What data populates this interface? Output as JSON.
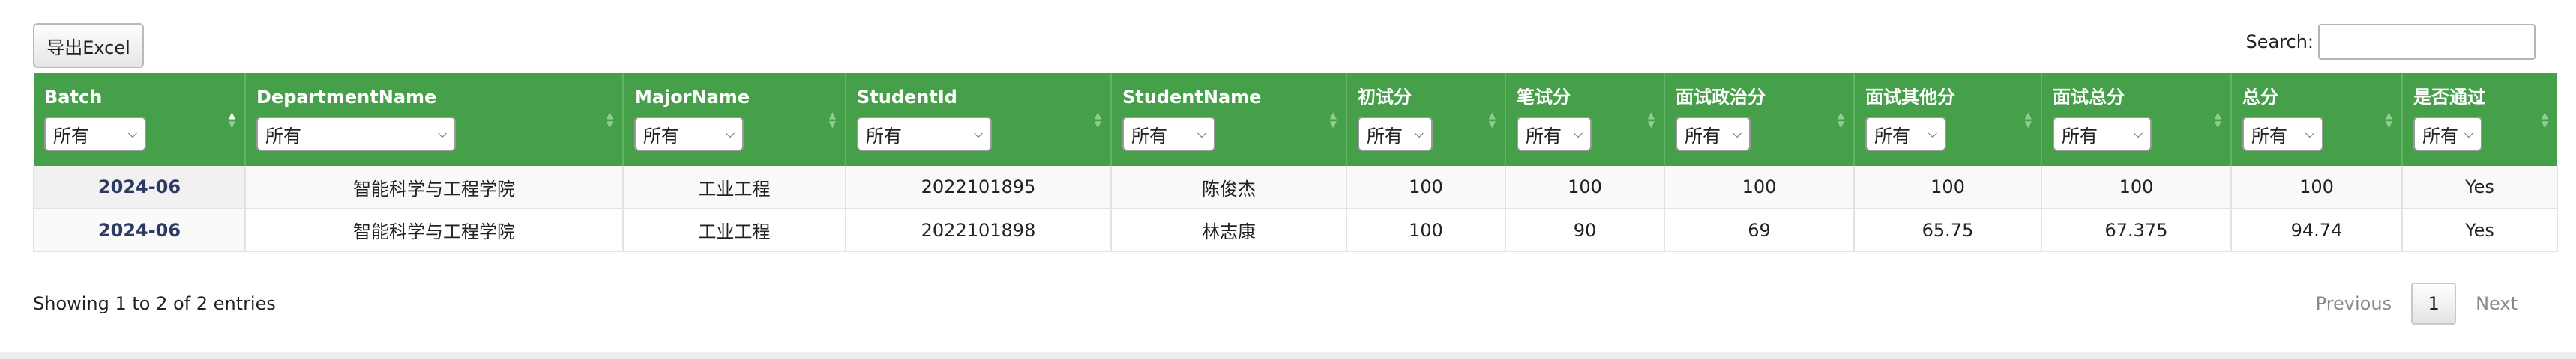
{
  "toolbar": {
    "export_label": "导出Excel",
    "search_label": "Search:",
    "search_value": ""
  },
  "filter_default": "所有",
  "columns": [
    {
      "label": "Batch",
      "filter": "所有"
    },
    {
      "label": "DepartmentName",
      "filter": "所有"
    },
    {
      "label": "MajorName",
      "filter": "所有"
    },
    {
      "label": "StudentId",
      "filter": "所有"
    },
    {
      "label": "StudentName",
      "filter": "所有"
    },
    {
      "label": "初试分",
      "filter": "所有"
    },
    {
      "label": "笔试分",
      "filter": "所有"
    },
    {
      "label": "面试政治分",
      "filter": "所有"
    },
    {
      "label": "面试其他分",
      "filter": "所有"
    },
    {
      "label": "面试总分",
      "filter": "所有"
    },
    {
      "label": "总分",
      "filter": "所有"
    },
    {
      "label": "是否通过",
      "filter": "所有"
    }
  ],
  "rows": [
    [
      "2024-06",
      "智能科学与工程学院",
      "工业工程",
      "2022101895",
      "陈俊杰",
      "100",
      "100",
      "100",
      "100",
      "100",
      "100",
      "Yes"
    ],
    [
      "2024-06",
      "智能科学与工程学院",
      "工业工程",
      "2022101898",
      "林志康",
      "100",
      "90",
      "69",
      "65.75",
      "67.375",
      "94.74",
      "Yes"
    ]
  ],
  "footer": {
    "info": "Showing 1 to 2 of 2 entries",
    "previous": "Previous",
    "current_page": "1",
    "next": "Next"
  },
  "colors": {
    "header_green": "#46a04a",
    "batch_text": "#2e3a63"
  },
  "sorting": {
    "column": "Batch",
    "direction": "ascending"
  }
}
